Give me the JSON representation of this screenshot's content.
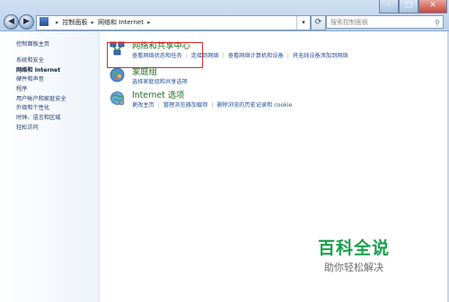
{
  "window": {
    "controls": {
      "minimize": "–",
      "maximize": "□",
      "close": "✕"
    }
  },
  "nav": {
    "back": "◀",
    "forward": "▶"
  },
  "address": {
    "segments": [
      "控制面板",
      "网络和 Internet"
    ],
    "separator": "▸"
  },
  "search": {
    "placeholder": "搜索控制面板"
  },
  "left_pane": {
    "home": "控制面板主页",
    "items": [
      {
        "label": "系统和安全",
        "current": false
      },
      {
        "label": "网络和 Internet",
        "current": true
      },
      {
        "label": "硬件和声音",
        "current": false
      },
      {
        "label": "程序",
        "current": false
      },
      {
        "label": "用户帐户和家庭安全",
        "current": false
      },
      {
        "label": "外观和个性化",
        "current": false
      },
      {
        "label": "时钟、语言和区域",
        "current": false
      },
      {
        "label": "轻松访问",
        "current": false
      }
    ]
  },
  "categories": [
    {
      "title": "网络和共享中心",
      "icon": "network-sharing-center-icon",
      "highlighted": true,
      "links": [
        "查看网络状态和任务",
        "连接到网络",
        "查看网络计算机和设备",
        "将无线设备添加到网络"
      ]
    },
    {
      "title": "家庭组",
      "icon": "homegroup-icon",
      "highlighted": false,
      "links": [
        "选择家庭组和共享选项"
      ]
    },
    {
      "title": "Internet 选项",
      "icon": "internet-options-icon",
      "highlighted": false,
      "links": [
        "更改主页",
        "管理浏览器加载项",
        "删除浏览的历史记录和 cookie"
      ]
    }
  ],
  "watermark": {
    "main": "百科全说",
    "sub": "助你轻松解决"
  },
  "colors": {
    "accent_green": "#1e6d1e",
    "link_blue": "#1e4f9a",
    "highlight_red": "#e0262a",
    "watermark_green": "#17a04c"
  }
}
